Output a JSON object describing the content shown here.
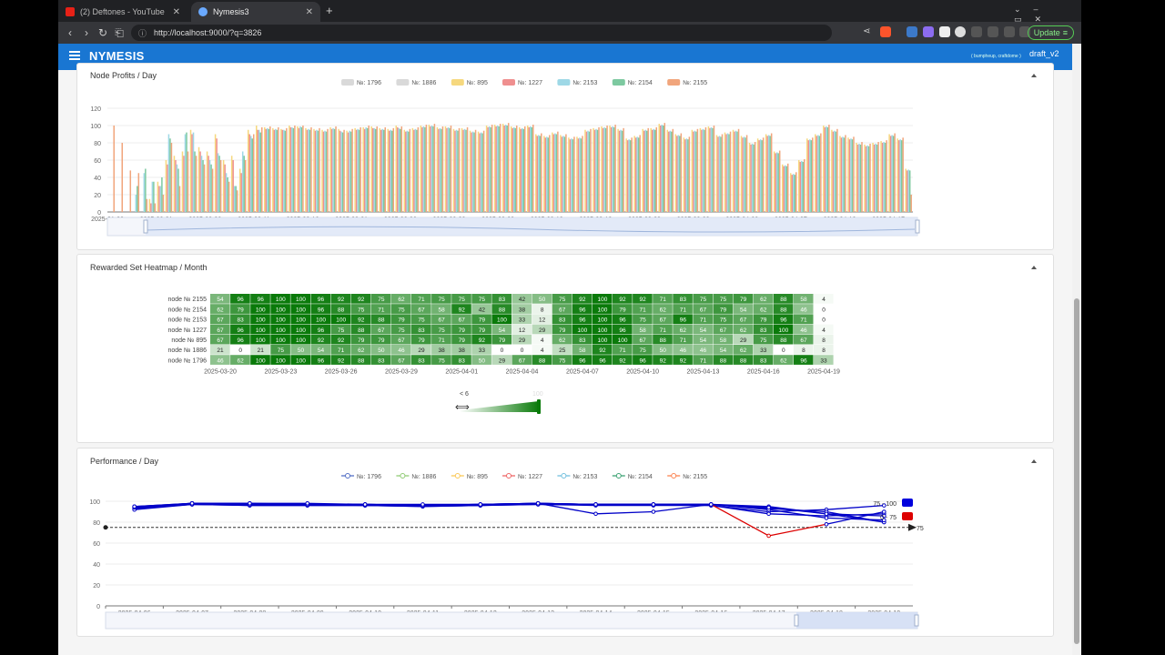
{
  "browser": {
    "tabs": [
      {
        "title": "(2) Deftones - YouTube",
        "active": false,
        "color": "#e62117"
      },
      {
        "title": "Nymesis3",
        "active": true,
        "color": "#6aa9ff"
      }
    ],
    "new_tab": "+",
    "url": "http://localhost:9000/?q=3826",
    "update_label": "Update"
  },
  "app": {
    "brand": "NYMESIS",
    "user": "( bumpheup, craftdome )",
    "draft": "draft_v2",
    "accent": "#1976d2"
  },
  "profits": {
    "title": "Node Profits / Day",
    "legend": [
      {
        "name": "№: 1796",
        "color": "#d9d9d9"
      },
      {
        "name": "№: 1886",
        "color": "#d9d9d9"
      },
      {
        "name": "№: 895",
        "color": "#f6d87e"
      },
      {
        "name": "№: 1227",
        "color": "#ef8f8f"
      },
      {
        "name": "№: 2153",
        "color": "#9ed8e6"
      },
      {
        "name": "№: 2154",
        "color": "#7dc9a0"
      },
      {
        "name": "№: 2155",
        "color": "#f1a57c"
      }
    ],
    "yticks": [
      "0",
      "20",
      "40",
      "60",
      "80",
      "100",
      "120"
    ],
    "xticks": [
      "2025-01-26",
      "2025-02-01",
      "2025-02-06",
      "2025-02-11",
      "2025-02-16",
      "2025-02-21",
      "2025-02-26",
      "2025-03-03",
      "2025-03-08",
      "2025-03-13",
      "2025-03-18",
      "2025-03-23",
      "2025-03-28",
      "2025-04-02",
      "2025-04-07",
      "2025-04-12",
      "2025-04-17"
    ]
  },
  "heatmap": {
    "title": "Rewarded Set Heatmap / Month",
    "rows": [
      "node № 2155",
      "node № 2154",
      "node № 2153",
      "node № 1227",
      "node № 895",
      "node № 1886",
      "node № 1796"
    ],
    "xticks": [
      "2025-03-20",
      "2025-03-23",
      "2025-03-26",
      "2025-03-29",
      "2025-04-01",
      "2025-04-04",
      "2025-04-07",
      "2025-04-10",
      "2025-04-13",
      "2025-04-16",
      "2025-04-19"
    ],
    "values": [
      [
        54,
        96,
        96,
        100,
        100,
        96,
        92,
        92,
        75,
        62,
        71,
        75,
        75,
        75,
        83,
        42,
        50,
        75,
        92,
        100,
        92,
        92,
        71,
        83,
        75,
        75,
        79,
        62,
        88,
        58,
        4
      ],
      [
        62,
        79,
        100,
        100,
        100,
        96,
        88,
        75,
        71,
        75,
        67,
        58,
        92,
        42,
        88,
        38,
        8,
        67,
        96,
        100,
        79,
        71,
        62,
        71,
        67,
        79,
        54,
        62,
        88,
        46,
        0
      ],
      [
        67,
        83,
        100,
        100,
        100,
        100,
        100,
        92,
        88,
        79,
        75,
        67,
        67,
        79,
        100,
        33,
        12,
        83,
        96,
        100,
        96,
        75,
        67,
        96,
        71,
        75,
        67,
        79,
        96,
        71,
        0
      ],
      [
        67,
        96,
        100,
        100,
        100,
        96,
        75,
        88,
        67,
        75,
        83,
        75,
        79,
        79,
        54,
        12,
        29,
        79,
        100,
        100,
        96,
        58,
        71,
        62,
        54,
        67,
        62,
        83,
        100,
        46,
        4
      ],
      [
        67,
        96,
        100,
        100,
        100,
        92,
        92,
        79,
        79,
        67,
        79,
        71,
        79,
        92,
        79,
        29,
        4,
        62,
        83,
        100,
        100,
        67,
        88,
        71,
        54,
        58,
        29,
        75,
        88,
        67,
        8
      ],
      [
        21,
        0,
        21,
        75,
        50,
        54,
        71,
        62,
        50,
        46,
        29,
        38,
        38,
        33,
        0,
        0,
        4,
        25,
        58,
        92,
        71,
        75,
        50,
        46,
        46,
        54,
        62,
        33,
        0,
        8,
        8
      ],
      [
        46,
        62,
        100,
        100,
        100,
        96,
        92,
        88,
        83,
        67,
        83,
        75,
        83,
        50,
        29,
        67,
        88,
        75,
        96,
        96,
        92,
        96,
        92,
        92,
        71,
        88,
        88,
        83,
        62,
        96,
        33
      ]
    ],
    "scale_min_label": "< 6",
    "scale_max_label": "100",
    "scale_color": "#0a7a0a"
  },
  "performance": {
    "title": "Performance / Day",
    "legend": [
      {
        "name": "№: 1796",
        "color": "#5470c6"
      },
      {
        "name": "№: 1886",
        "color": "#91cc75"
      },
      {
        "name": "№: 895",
        "color": "#fac858"
      },
      {
        "name": "№: 1227",
        "color": "#ee6666"
      },
      {
        "name": "№: 2153",
        "color": "#73c0de"
      },
      {
        "name": "№: 2154",
        "color": "#3ba272"
      },
      {
        "name": "№: 2155",
        "color": "#fc8452"
      }
    ],
    "yticks": [
      "0",
      "20",
      "40",
      "60",
      "80",
      "100"
    ],
    "xticks": [
      "2025-04-06",
      "2025-04-07",
      "2025-04-08",
      "2025-04-09",
      "2025-04-10",
      "2025-04-11",
      "2025-04-12",
      "2025-04-13",
      "2025-04-14",
      "2025-04-15",
      "2025-04-16",
      "2025-04-17",
      "2025-04-18",
      "2025-04-19"
    ],
    "threshold_label": "75",
    "visual_map": [
      {
        "label": "75 - 100",
        "color": "#0000dd"
      },
      {
        "label": "0 - 75",
        "color": "#dd0000"
      }
    ]
  },
  "chart_data": [
    {
      "type": "bar",
      "title": "Node Profits / Day",
      "ylim": [
        0,
        120
      ],
      "x_range": [
        "2025-01-26",
        "2025-04-19"
      ],
      "series": [
        {
          "name": "№: 895",
          "values": [
            0,
            0,
            0,
            0,
            0,
            15,
            35,
            60,
            65,
            70,
            95,
            75,
            70,
            90,
            60,
            65,
            50,
            95,
            100,
            98,
            97,
            96,
            100,
            99,
            97,
            96,
            95,
            98,
            96,
            94,
            97,
            98,
            99,
            97,
            96,
            100,
            95,
            97,
            100,
            101,
            98,
            99,
            96,
            97,
            94,
            93,
            100,
            101,
            102,
            99,
            98,
            100,
            90,
            88,
            92,
            89,
            86,
            87,
            95,
            97,
            99,
            100,
            96,
            85,
            88,
            96,
            97,
            102,
            95,
            90,
            86,
            95,
            97,
            99,
            89,
            92,
            95,
            88,
            80,
            85,
            90,
            70,
            55,
            45,
            60,
            85,
            90,
            100,
            95,
            88,
            86,
            80,
            78,
            80,
            82,
            90,
            85,
            50
          ]
        },
        {
          "name": "№: 1227",
          "values": [
            0,
            0,
            0,
            0,
            0,
            10,
            30,
            55,
            60,
            65,
            90,
            70,
            65,
            85,
            55,
            60,
            45,
            90,
            95,
            96,
            95,
            95,
            98,
            97,
            95,
            94,
            93,
            96,
            94,
            92,
            95,
            96,
            97,
            95,
            94,
            98,
            93,
            95,
            98,
            99,
            96,
            97,
            94,
            95,
            92,
            91,
            98,
            99,
            100,
            97,
            96,
            98,
            88,
            86,
            90,
            87,
            84,
            85,
            93,
            95,
            97,
            98,
            94,
            83,
            86,
            94,
            95,
            100,
            93,
            88,
            84,
            93,
            95,
            97,
            87,
            90,
            93,
            86,
            78,
            83,
            88,
            68,
            53,
            43,
            58,
            83,
            88,
            98,
            93,
            86,
            84,
            78,
            76,
            78,
            80,
            88,
            83,
            48
          ]
        },
        {
          "name": "№: 2153",
          "values": [
            0,
            0,
            0,
            20,
            45,
            35,
            30,
            90,
            55,
            90,
            92,
            65,
            60,
            68,
            45,
            30,
            70,
            88,
            95,
            97,
            96,
            95,
            98,
            99,
            96,
            95,
            94,
            97,
            93,
            94,
            96,
            98,
            97,
            96,
            95,
            97,
            94,
            96,
            99,
            100,
            97,
            98,
            95,
            96,
            93,
            92,
            99,
            100,
            101,
            98,
            97,
            99,
            89,
            87,
            91,
            88,
            85,
            86,
            94,
            96,
            98,
            99,
            95,
            84,
            87,
            95,
            96,
            101,
            94,
            89,
            85,
            94,
            96,
            98,
            88,
            91,
            94,
            87,
            79,
            84,
            89,
            69,
            54,
            44,
            59,
            84,
            89,
            99,
            94,
            87,
            85,
            79,
            77,
            79,
            81,
            89,
            84,
            49
          ]
        },
        {
          "name": "№: 2154",
          "values": [
            0,
            0,
            0,
            30,
            50,
            35,
            40,
            85,
            50,
            92,
            70,
            60,
            55,
            65,
            40,
            30,
            65,
            85,
            92,
            96,
            95,
            94,
            97,
            98,
            95,
            94,
            93,
            96,
            92,
            93,
            95,
            97,
            96,
            95,
            94,
            96,
            93,
            95,
            98,
            99,
            96,
            97,
            94,
            95,
            92,
            91,
            98,
            99,
            100,
            97,
            96,
            98,
            88,
            86,
            90,
            87,
            84,
            85,
            93,
            95,
            97,
            98,
            94,
            83,
            86,
            94,
            95,
            100,
            93,
            88,
            84,
            93,
            95,
            97,
            87,
            90,
            93,
            86,
            78,
            83,
            88,
            68,
            53,
            43,
            58,
            83,
            88,
            98,
            93,
            86,
            84,
            78,
            76,
            78,
            80,
            88,
            83,
            48
          ]
        },
        {
          "name": "№: 2155",
          "values": [
            100,
            80,
            48,
            45,
            15,
            10,
            20,
            80,
            30,
            70,
            65,
            55,
            50,
            60,
            35,
            25,
            60,
            90,
            98,
            99,
            98,
            97,
            100,
            100,
            98,
            97,
            96,
            99,
            95,
            96,
            98,
            100,
            99,
            98,
            97,
            99,
            96,
            98,
            101,
            102,
            99,
            100,
            97,
            98,
            95,
            94,
            101,
            102,
            103,
            100,
            99,
            101,
            91,
            89,
            93,
            90,
            87,
            88,
            96,
            98,
            100,
            101,
            97,
            86,
            89,
            97,
            98,
            103,
            96,
            91,
            87,
            96,
            98,
            100,
            90,
            93,
            96,
            89,
            81,
            86,
            91,
            71,
            56,
            46,
            61,
            86,
            91,
            101,
            96,
            89,
            87,
            81,
            79,
            81,
            83,
            91,
            86,
            20
          ]
        }
      ]
    },
    {
      "type": "heatmap",
      "title": "Rewarded Set Heatmap / Month",
      "x_range": [
        "2025-03-20",
        "2025-04-19"
      ],
      "rows": [
        "node № 2155",
        "node № 2154",
        "node № 2153",
        "node № 1227",
        "node № 895",
        "node № 1886",
        "node № 1796"
      ]
    },
    {
      "type": "line",
      "title": "Performance / Day",
      "categories": [
        "2025-04-06",
        "2025-04-07",
        "2025-04-08",
        "2025-04-09",
        "2025-04-10",
        "2025-04-11",
        "2025-04-12",
        "2025-04-13",
        "2025-04-14",
        "2025-04-15",
        "2025-04-16",
        "2025-04-17",
        "2025-04-18",
        "2025-04-19"
      ],
      "ylim": [
        0,
        100
      ],
      "threshold": 75,
      "series": [
        {
          "name": "№: 1796",
          "values": [
            95,
            98,
            98,
            97,
            97,
            96,
            96,
            98,
            88,
            90,
            97,
            95,
            88,
            80
          ]
        },
        {
          "name": "№: 1886",
          "values": [
            94,
            97,
            97,
            97,
            96,
            96,
            97,
            98,
            97,
            97,
            96,
            90,
            92,
            96
          ]
        },
        {
          "name": "№: 895",
          "values": [
            93,
            97,
            96,
            96,
            96,
            95,
            96,
            97,
            96,
            96,
            96,
            88,
            86,
            88
          ]
        },
        {
          "name": "№: 1227",
          "values": [
            92,
            97,
            96,
            96,
            96,
            95,
            96,
            97,
            97,
            97,
            97,
            67,
            78,
            90
          ]
        },
        {
          "name": "№: 2153",
          "values": [
            94,
            98,
            97,
            97,
            97,
            96,
            97,
            98,
            97,
            97,
            97,
            93,
            90,
            80
          ]
        },
        {
          "name": "№: 2154",
          "values": [
            94,
            98,
            97,
            97,
            97,
            96,
            97,
            98,
            97,
            97,
            97,
            92,
            84,
            82
          ]
        },
        {
          "name": "№: 2155",
          "values": [
            95,
            98,
            98,
            98,
            97,
            97,
            97,
            98,
            97,
            97,
            97,
            94,
            88,
            86
          ]
        }
      ]
    }
  ]
}
